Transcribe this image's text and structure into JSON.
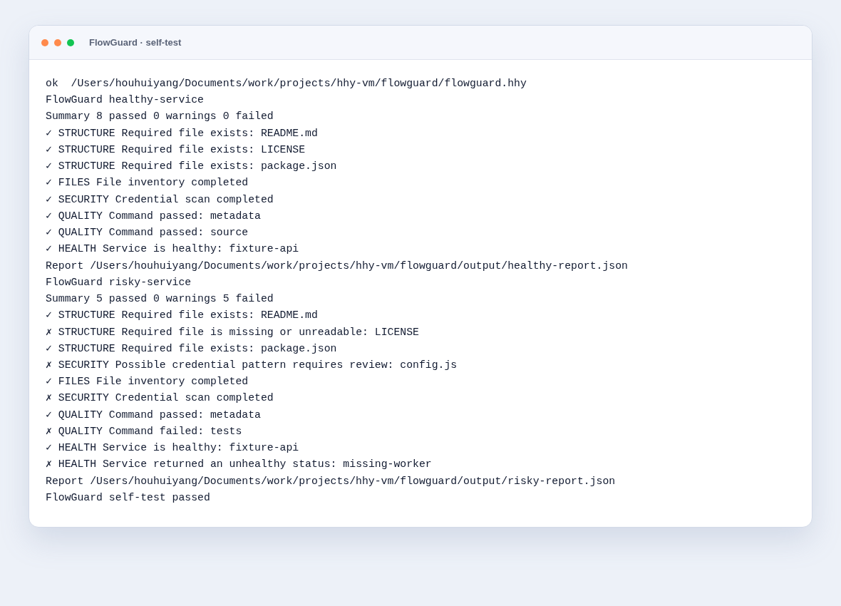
{
  "window": {
    "title": "FlowGuard · self-test",
    "controls": [
      {
        "color": "#ff8a4c"
      },
      {
        "color": "#ff8a4c"
      },
      {
        "color": "#12c452"
      }
    ]
  },
  "output": {
    "lines": [
      "ok  /Users/houhuiyang/Documents/work/projects/hhy-vm/flowguard/flowguard.hhy",
      "FlowGuard healthy-service",
      "Summary 8 passed 0 warnings 0 failed",
      "✓ STRUCTURE Required file exists: README.md",
      "✓ STRUCTURE Required file exists: LICENSE",
      "✓ STRUCTURE Required file exists: package.json",
      "✓ FILES File inventory completed",
      "✓ SECURITY Credential scan completed",
      "✓ QUALITY Command passed: metadata",
      "✓ QUALITY Command passed: source",
      "✓ HEALTH Service is healthy: fixture-api",
      "Report /Users/houhuiyang/Documents/work/projects/hhy-vm/flowguard/output/healthy-report.json",
      "FlowGuard risky-service",
      "Summary 5 passed 0 warnings 5 failed",
      "✓ STRUCTURE Required file exists: README.md",
      "✗ STRUCTURE Required file is missing or unreadable: LICENSE",
      "✓ STRUCTURE Required file exists: package.json",
      "✗ SECURITY Possible credential pattern requires review: config.js",
      "✓ FILES File inventory completed",
      "✗ SECURITY Credential scan completed",
      "✓ QUALITY Command passed: metadata",
      "✗ QUALITY Command failed: tests",
      "✓ HEALTH Service is healthy: fixture-api",
      "✗ HEALTH Service returned an unhealthy status: missing-worker",
      "Report /Users/houhuiyang/Documents/work/projects/hhy-vm/flowguard/output/risky-report.json",
      "FlowGuard self-test passed"
    ]
  }
}
